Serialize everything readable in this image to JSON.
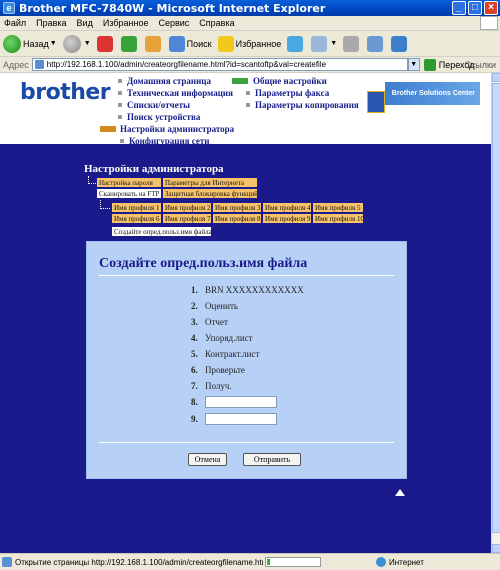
{
  "window": {
    "title": "Brother MFC-7840W - Microsoft Internet Explorer"
  },
  "menu": [
    "Файл",
    "Правка",
    "Вид",
    "Избранное",
    "Сервис",
    "Справка"
  ],
  "toolbar": {
    "back_label": "Назад",
    "search_label": "Поиск",
    "favorites_label": "Избранное"
  },
  "address": {
    "label": "Адрес",
    "url": "http://192.168.1.100/admin/createorgfilename.html?id=scantoftp&val=createfile",
    "go_label": "Переход",
    "links_label": "Ссылки"
  },
  "header": {
    "logo": "brother",
    "nav_left": [
      "Домашняя страница",
      "Техническая информация",
      "Списки/отчеты",
      "Поиск устройства",
      "Настройки администратора",
      "Конфигурация сети"
    ],
    "nav_right": [
      "Общие настройки",
      "Параметры факса",
      "Параметры копирования"
    ],
    "solutions": "Brother Solutions Center"
  },
  "admin": {
    "title": "Настройки администратора",
    "tabs_row1": [
      "Настройка пароля",
      "Параметры для Интернета"
    ],
    "tabs_row2": [
      "Сканировать на FTP",
      "Защитная блокировка функций"
    ],
    "profiles": [
      "Имя профиля 1",
      "Имя профиля 2",
      "Имя профиля 3",
      "Имя профиля 4",
      "Имя профиля 5",
      "Имя профиля 6",
      "Имя профиля 7",
      "Имя профиля 8",
      "Имя профиля 9",
      "Имя профиля 10"
    ],
    "subtab": "Создайте опред.польз.имя файла"
  },
  "form": {
    "title": "Создайте опред.польз.имя файла",
    "items": [
      {
        "num": "1.",
        "text": "BRN XXXXXXXXXXXX"
      },
      {
        "num": "2.",
        "text": "Оценить"
      },
      {
        "num": "3.",
        "text": "Отчет"
      },
      {
        "num": "4.",
        "text": "Упоряд.лист"
      },
      {
        "num": "5.",
        "text": "Контракт.лист"
      },
      {
        "num": "6.",
        "text": "Проверьте"
      },
      {
        "num": "7.",
        "text": "Получ."
      },
      {
        "num": "8.",
        "value": ""
      },
      {
        "num": "9.",
        "value": ""
      }
    ],
    "cancel_label": "Отмена",
    "submit_label": "Отправить"
  },
  "status": {
    "text": "Открытие страницы http://192.168.1.100/admin/createorgfilename.html?id=sca",
    "progress": 0.05,
    "zone": "Интернет"
  }
}
